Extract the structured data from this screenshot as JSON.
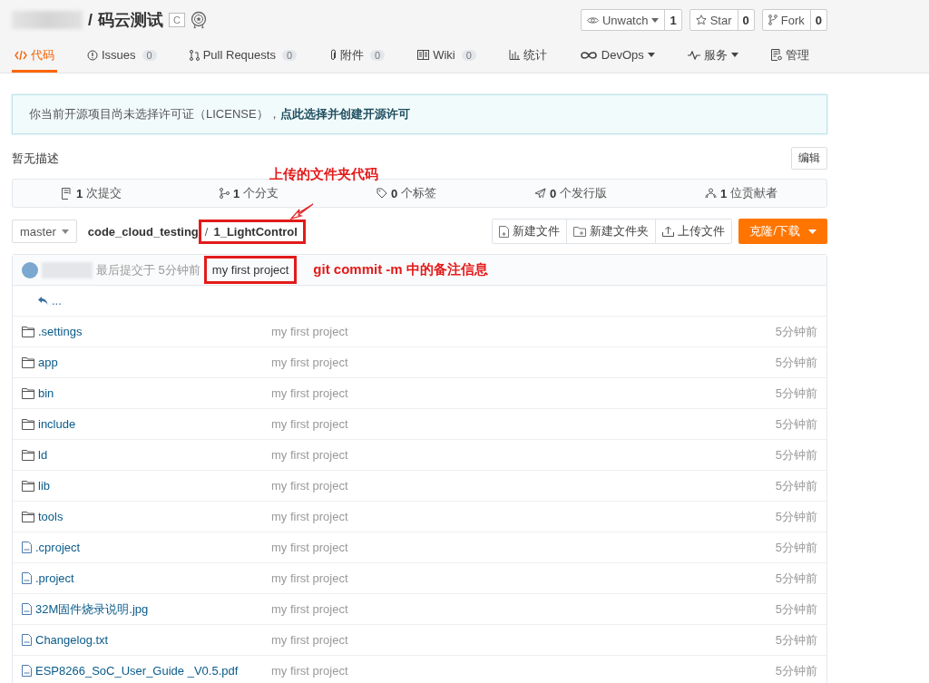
{
  "repo": {
    "separator": "/",
    "name": "码云测试",
    "badge": "C"
  },
  "actions": [
    {
      "kind": "watch",
      "label": "Unwatch",
      "count": "1",
      "dropdown": true
    },
    {
      "kind": "star",
      "label": "Star",
      "count": "0"
    },
    {
      "kind": "fork",
      "label": "Fork",
      "count": "0"
    }
  ],
  "tabs": [
    {
      "kind": "code",
      "label": "代码",
      "selected": true
    },
    {
      "kind": "issues",
      "label": "Issues",
      "count": "0",
      "selected": false
    },
    {
      "kind": "pr",
      "label": "Pull Requests",
      "count": "0",
      "selected": false
    },
    {
      "kind": "attach",
      "label": "附件",
      "count": "0",
      "selected": false
    },
    {
      "kind": "wiki",
      "label": "Wiki",
      "count": "0",
      "selected": false
    },
    {
      "kind": "stats",
      "label": "统计",
      "selected": false
    },
    {
      "kind": "devops",
      "label": "DevOps",
      "dropdown": true,
      "selected": false
    },
    {
      "kind": "service",
      "label": "服务",
      "dropdown": true,
      "selected": false
    },
    {
      "kind": "manage",
      "label": "管理",
      "selected": false
    }
  ],
  "notice": {
    "text": "你当前开源项目尚未选择许可证（LICENSE），",
    "link": "点此选择并创建开源许可"
  },
  "description": "暂无描述",
  "edit_button": "编辑",
  "stats": [
    {
      "kind": "commit",
      "count": "1",
      "label": "次提交"
    },
    {
      "kind": "branch",
      "count": "1",
      "label": "个分支"
    },
    {
      "kind": "tag",
      "count": "0",
      "label": "个标签"
    },
    {
      "kind": "release",
      "count": "0",
      "label": "个发行版"
    },
    {
      "kind": "contrib",
      "count": "1",
      "label": "位贡献者"
    }
  ],
  "branch": "master",
  "breadcrumb_separator": "/",
  "breadcrumb": [
    {
      "label": "code_cloud_testing",
      "highlighted": false
    },
    {
      "label": "1_LightControl",
      "highlighted": true
    }
  ],
  "file_buttons": [
    {
      "kind": "file",
      "label": "新建文件"
    },
    {
      "kind": "folder",
      "label": "新建文件夹"
    },
    {
      "kind": "upload",
      "label": "上传文件"
    }
  ],
  "clone_button": "克隆/下载",
  "last_commit": {
    "prefix": "最后提交于 5分钟前",
    "message": "my first project",
    "highlighted": true
  },
  "parent_link": "...",
  "files": [
    {
      "kind": "folder",
      "name": ".settings",
      "message": "my first project",
      "time": "5分钟前"
    },
    {
      "kind": "folder",
      "name": "app",
      "message": "my first project",
      "time": "5分钟前"
    },
    {
      "kind": "folder",
      "name": "bin",
      "message": "my first project",
      "time": "5分钟前"
    },
    {
      "kind": "folder",
      "name": "include",
      "message": "my first project",
      "time": "5分钟前"
    },
    {
      "kind": "folder",
      "name": "ld",
      "message": "my first project",
      "time": "5分钟前"
    },
    {
      "kind": "folder",
      "name": "lib",
      "message": "my first project",
      "time": "5分钟前"
    },
    {
      "kind": "folder",
      "name": "tools",
      "message": "my first project",
      "time": "5分钟前"
    },
    {
      "kind": "file",
      "name": ".cproject",
      "message": "my first project",
      "time": "5分钟前"
    },
    {
      "kind": "file",
      "name": ".project",
      "message": "my first project",
      "time": "5分钟前"
    },
    {
      "kind": "file",
      "name": "32M固件烧录说明.jpg",
      "message": "my first project",
      "time": "5分钟前"
    },
    {
      "kind": "file",
      "name": "Changelog.txt",
      "message": "my first project",
      "time": "5分钟前"
    },
    {
      "kind": "file",
      "name": "ESP8266_SoC_User_Guide _V0.5.pdf",
      "message": "my first project",
      "time": "5分钟前"
    }
  ],
  "annotations": [
    {
      "text": "上传的文件夹代码"
    },
    {
      "text": "git  commit -m 中的备注信息"
    }
  ]
}
